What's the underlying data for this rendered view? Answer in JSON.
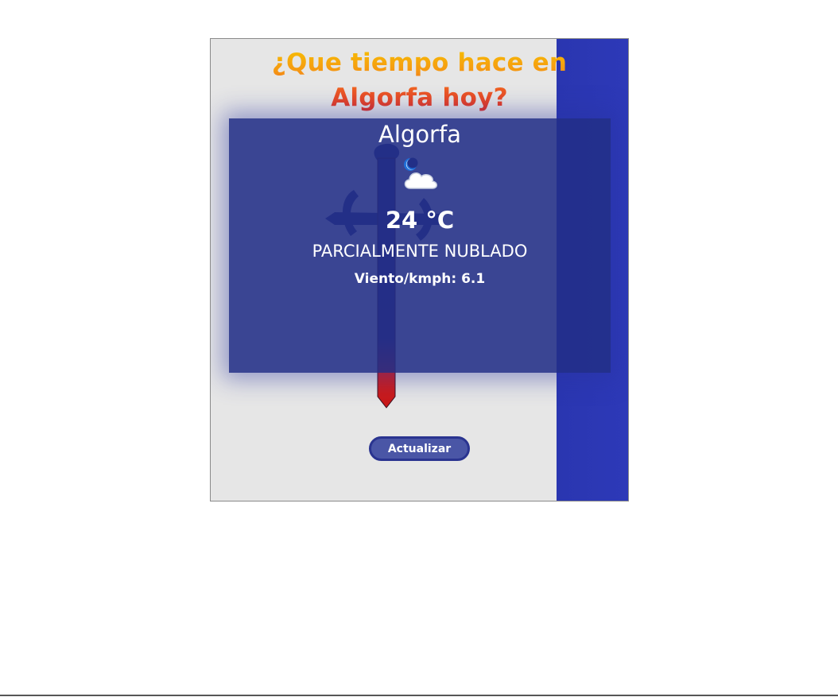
{
  "header": {
    "title_line1": "¿Que tiempo hace en",
    "title_line2": "Algorfa hoy?"
  },
  "weather": {
    "city": "Algorfa",
    "icon": "partly-cloudy-night-icon",
    "temperature": "24 °C",
    "description": "PARCIALMENTE NUBLADO",
    "wind": "Viento/kmph: 6.1"
  },
  "actions": {
    "refresh_label": "Actualizar"
  },
  "colors": {
    "card_bg": "#222F87",
    "stripe": "#2A36B0",
    "title_gradient_top": "#F7C400",
    "title_gradient_bottom": "#E02424",
    "button_bg": "#4A56A6",
    "button_border": "#2A3490"
  }
}
